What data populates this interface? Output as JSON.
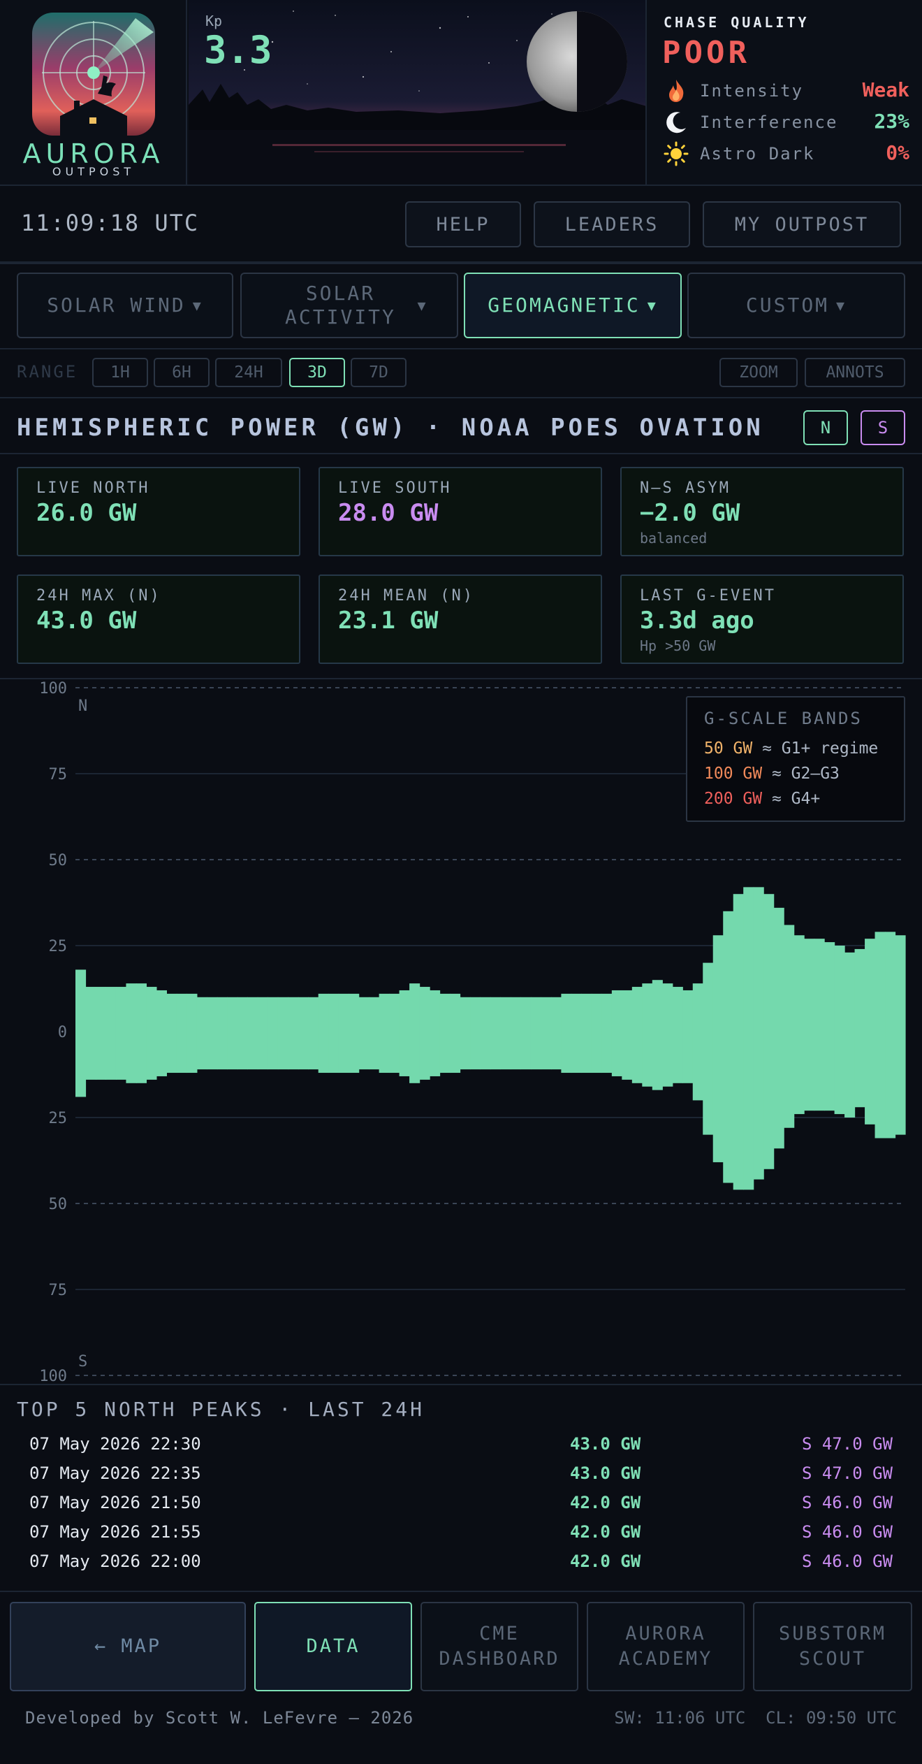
{
  "brand": {
    "title": "AURORA",
    "subtitle": "OUTPOST"
  },
  "kp": {
    "label": "Kp",
    "value": "3.3"
  },
  "chase": {
    "title": "CHASE QUALITY",
    "value": "POOR",
    "rows": [
      {
        "icon": "flame-icon",
        "label": "Intensity",
        "value": "Weak",
        "color": "#f0605c"
      },
      {
        "icon": "moon-icon",
        "label": "Interference",
        "value": "23%",
        "color": "#7fe0b6"
      },
      {
        "icon": "sun-icon",
        "label": "Astro Dark",
        "value": "0%",
        "color": "#f0605c"
      }
    ]
  },
  "topbar": {
    "clock": "11:09:18 UTC",
    "help": "HELP",
    "leaders": "LEADERS",
    "outpost": "MY OUTPOST"
  },
  "categories": [
    {
      "label": "SOLAR WIND",
      "caret": "▼"
    },
    {
      "label": "SOLAR ACTIVITY",
      "caret": "▼"
    },
    {
      "label": "GEOMAGNETIC",
      "caret": "▼"
    },
    {
      "label": "CUSTOM",
      "caret": "▼"
    }
  ],
  "range": {
    "label": "RANGE",
    "options": [
      "1H",
      "6H",
      "24H",
      "3D",
      "7D"
    ],
    "selected": "3D",
    "zoom": "ZOOM",
    "annots": "ANNOTS"
  },
  "panel": {
    "title": "HEMISPHERIC POWER (GW) · NOAA POES OVATION",
    "north_btn": "N",
    "south_btn": "S"
  },
  "stats": [
    {
      "label": "LIVE NORTH",
      "value": "26.0 GW",
      "sub": "",
      "color": "#7fe0b6"
    },
    {
      "label": "LIVE SOUTH",
      "value": "28.0 GW",
      "sub": "",
      "color": "#c98cf0"
    },
    {
      "label": "N–S ASYM",
      "value": "−2.0 GW",
      "sub": "balanced",
      "color": "#7fe0b6"
    },
    {
      "label": "24H MAX (N)",
      "value": "43.0 GW",
      "sub": "",
      "color": "#7fe0b6"
    },
    {
      "label": "24H MEAN (N)",
      "value": "23.1 GW",
      "sub": "",
      "color": "#7fe0b6"
    },
    {
      "label": "LAST G-EVENT",
      "value": "3.3d ago",
      "sub": "Hp >50 GW",
      "color": "#7fe0b6"
    }
  ],
  "gscale": {
    "title": "G-SCALE BANDS",
    "bands": [
      {
        "value": "50 GW",
        "desc": "≈ G1+ regime",
        "color": "#f1b36a"
      },
      {
        "value": "100 GW",
        "desc": "≈ G2–G3",
        "color": "#f28a5a"
      },
      {
        "value": "200 GW",
        "desc": "≈ G4+",
        "color": "#f0605c"
      }
    ]
  },
  "chart_data": {
    "type": "area",
    "ylim": [
      -100,
      100
    ],
    "y_tick_labels": [
      "100",
      "75",
      "50",
      "25",
      "0",
      "25",
      "50",
      "75",
      "100"
    ],
    "top_label": "N",
    "bottom_label": "S",
    "color": "#74d9ad",
    "series": [
      {
        "name": "N",
        "values": [
          18,
          13,
          13,
          13,
          13,
          14,
          14,
          13,
          12,
          11,
          11,
          11,
          10,
          10,
          10,
          10,
          10,
          10,
          10,
          10,
          10,
          10,
          10,
          10,
          11,
          11,
          11,
          11,
          10,
          10,
          11,
          11,
          12,
          14,
          13,
          12,
          11,
          11,
          10,
          10,
          10,
          10,
          10,
          10,
          10,
          10,
          10,
          10,
          11,
          11,
          11,
          11,
          11,
          12,
          12,
          13,
          14,
          15,
          14,
          13,
          12,
          14,
          20,
          28,
          35,
          40,
          42,
          42,
          40,
          36,
          31,
          28,
          27,
          27,
          26,
          25,
          23,
          24,
          27,
          29,
          29,
          28
        ]
      },
      {
        "name": "S",
        "values": [
          19,
          14,
          14,
          14,
          14,
          15,
          15,
          14,
          13,
          12,
          12,
          12,
          11,
          11,
          11,
          11,
          11,
          11,
          11,
          11,
          11,
          11,
          11,
          11,
          12,
          12,
          12,
          12,
          11,
          11,
          12,
          12,
          13,
          15,
          14,
          13,
          12,
          12,
          11,
          11,
          11,
          11,
          11,
          11,
          11,
          11,
          11,
          11,
          12,
          12,
          12,
          12,
          12,
          13,
          14,
          15,
          16,
          17,
          16,
          15,
          15,
          20,
          30,
          38,
          44,
          46,
          46,
          43,
          40,
          34,
          28,
          24,
          23,
          23,
          23,
          24,
          25,
          22,
          27,
          31,
          31,
          30
        ]
      }
    ]
  },
  "peaks": {
    "title": "TOP 5 NORTH PEAKS · LAST 24H",
    "rows": [
      {
        "time": "07 May 2026 22:30",
        "north": "43.0 GW",
        "south": "S 47.0 GW"
      },
      {
        "time": "07 May 2026 22:35",
        "north": "43.0 GW",
        "south": "S 47.0 GW"
      },
      {
        "time": "07 May 2026 21:50",
        "north": "42.0 GW",
        "south": "S 46.0 GW"
      },
      {
        "time": "07 May 2026 21:55",
        "north": "42.0 GW",
        "south": "S 46.0 GW"
      },
      {
        "time": "07 May 2026 22:00",
        "north": "42.0 GW",
        "south": "S 46.0 GW"
      }
    ]
  },
  "nav": [
    "← MAP",
    "DATA",
    "CME DASHBOARD",
    "AURORA ACADEMY",
    "SUBSTORM SCOUT"
  ],
  "footer": {
    "credit": "Developed by Scott W. LeFevre — 2026",
    "status": "SW: 11:06 UTC  CL: 09:50 UTC"
  }
}
